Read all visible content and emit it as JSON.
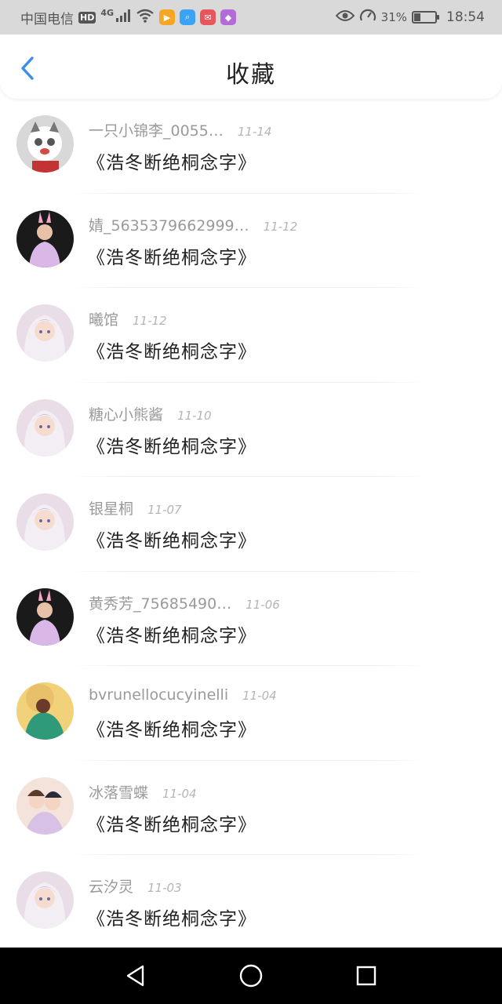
{
  "status_bar": {
    "carrier": "中国电信",
    "hd": "HD",
    "network": "4G",
    "battery": "31%",
    "battery_level": 0.31,
    "time": "18:54",
    "app_icons": [
      {
        "name": "video-app-icon",
        "color": "#f5a623"
      },
      {
        "name": "search-app-icon",
        "color": "#3aa3f5"
      },
      {
        "name": "mail-app-icon",
        "color": "#e8555a"
      },
      {
        "name": "gift-app-icon",
        "color": "#b26bd9"
      }
    ]
  },
  "header": {
    "title": "收藏",
    "back_icon": "chevron-left-icon",
    "accent_color": "#3a8ee6"
  },
  "items": [
    {
      "username": "一只小锦李_0055…",
      "date": "11-14",
      "title": "《浩冬断绝桐念字》",
      "avatar": "cat-avatar"
    },
    {
      "username": "婧_5635379662999…",
      "date": "11-12",
      "title": "《浩冬断绝桐念字》",
      "avatar": "child-avatar"
    },
    {
      "username": "曦馆",
      "date": "11-12",
      "title": "《浩冬断绝桐念字》",
      "avatar": "anime-girl-avatar"
    },
    {
      "username": "糖心小熊酱",
      "date": "11-10",
      "title": "《浩冬断绝桐念字》",
      "avatar": "anime-girl-avatar"
    },
    {
      "username": "银星桐",
      "date": "11-07",
      "title": "《浩冬断绝桐念字》",
      "avatar": "anime-girl-avatar"
    },
    {
      "username": "黄秀芳_75685490…",
      "date": "11-06",
      "title": "《浩冬断绝桐念字》",
      "avatar": "child-avatar"
    },
    {
      "username": "bvrunellocucyinelli",
      "date": "11-04",
      "title": "《浩冬断绝桐念字》",
      "avatar": "person-avatar"
    },
    {
      "username": "冰落雪蝶",
      "date": "11-04",
      "title": "《浩冬断绝桐念字》",
      "avatar": "anime-couple-avatar"
    },
    {
      "username": "云汐灵",
      "date": "11-03",
      "title": "《浩冬断绝桐念字》",
      "avatar": "anime-girl-avatar"
    }
  ],
  "nav_bar": {
    "back": "triangle-back-icon",
    "home": "circle-home-icon",
    "recents": "square-recents-icon"
  }
}
